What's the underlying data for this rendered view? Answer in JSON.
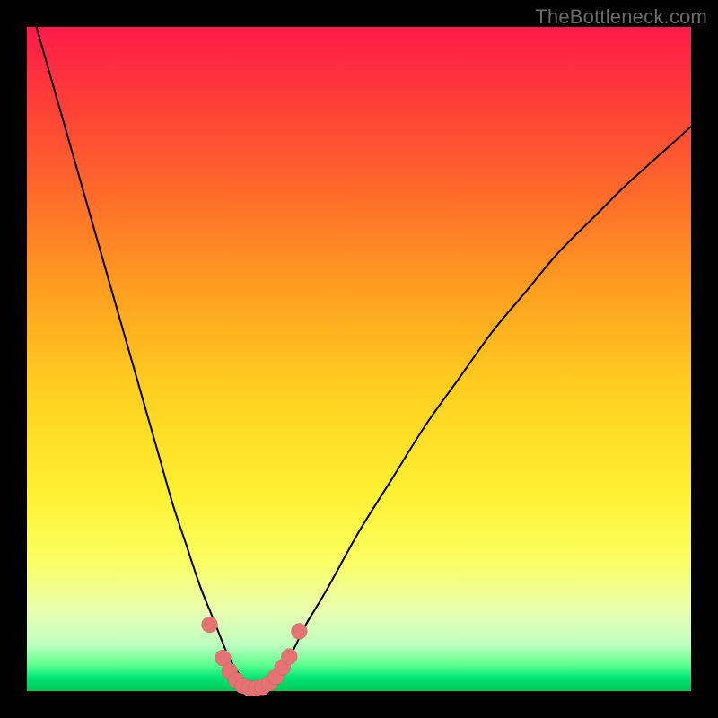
{
  "watermark": "TheBottleneck.com",
  "colors": {
    "page_bg": "#000000",
    "gradient_top": "#ff1a4a",
    "gradient_bottom": "#00c853",
    "curve": "#000000",
    "dot": "#e57373",
    "watermark": "#6a6a6a"
  },
  "chart_data": {
    "type": "line",
    "title": "",
    "xlabel": "",
    "ylabel": "",
    "xlim": [
      0,
      100
    ],
    "ylim": [
      0,
      100
    ],
    "grid": false,
    "legend": false,
    "series": [
      {
        "name": "bottleneck-curve",
        "x": [
          0,
          2,
          4,
          6,
          8,
          10,
          12,
          14,
          16,
          18,
          20,
          22,
          24,
          26,
          28,
          30,
          31,
          32,
          33,
          34,
          35,
          36,
          38,
          40,
          42,
          45,
          50,
          55,
          60,
          65,
          70,
          75,
          80,
          85,
          90,
          95,
          100
        ],
        "y": [
          105,
          98,
          91,
          84,
          77,
          70,
          63,
          56,
          49,
          42,
          35,
          28,
          22,
          16,
          11,
          6,
          4,
          2.5,
          1.2,
          0.5,
          0.5,
          1,
          3,
          6,
          10,
          15,
          24,
          32,
          40,
          47,
          54,
          60,
          66,
          71,
          76,
          80.5,
          85
        ]
      }
    ],
    "marker_points": {
      "name": "highlight-dots",
      "x": [
        27.5,
        29.5,
        30.5,
        31.5,
        32.5,
        33.5,
        34.5,
        35.5,
        36.5,
        37.5,
        38.5,
        39.5,
        41.0
      ],
      "y": [
        10.0,
        5.0,
        3.0,
        1.6,
        0.8,
        0.4,
        0.4,
        0.6,
        1.2,
        2.2,
        3.6,
        5.2,
        9.0
      ]
    },
    "annotations": []
  }
}
